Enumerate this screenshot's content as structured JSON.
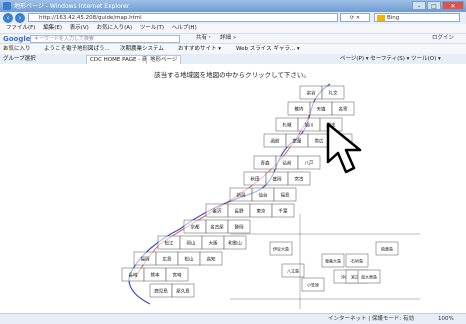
{
  "window": {
    "title": "地形ページ - Windows Internet Explorer",
    "buttons": [
      "–",
      "□",
      "✕"
    ]
  },
  "address_bar": {
    "url": "http://163.42.45.208/guide/map.html",
    "search_value": "Bing"
  },
  "menu": [
    "ファイル(F)",
    "編集(E)",
    "表示(V)",
    "お気に入り(A)",
    "ツール(T)",
    "ヘルプ(H)"
  ],
  "google_toolbar": {
    "logo": "Google",
    "search_placeholder": "キーワードを入力して検索",
    "share_label": "共有・",
    "more_label": "詳細 »",
    "login_label": "ログイン"
  },
  "favorites_bar": {
    "label": "お気に入り",
    "items": [
      "ようこそ電子地形図ぱう...",
      "次期農業システム",
      "おすすめサイト ▾",
      "Web スライス ギャラ... ▾"
    ]
  },
  "tab_bar": {
    "group_label": "グループ選択",
    "tabs": [
      "CDC HOME PAGE - 商品...",
      "地形ページ"
    ],
    "tools_label": "ページ(P) ▾  セーフティ(S) ▾  ツール(O) ▾"
  },
  "content": {
    "instruction": "該当する地域図を地図の中からクリックして下さい。",
    "rows": [
      {
        "cells": [
          {
            "label": "宗谷",
            "interactable": true
          },
          {
            "label": "礼文",
            "interactable": true
          }
        ]
      },
      {
        "cells": [
          {
            "label": "稚内",
            "interactable": true
          },
          {
            "label": "天塩",
            "interactable": true
          },
          {
            "label": "名寄",
            "interactable": true
          }
        ]
      },
      {
        "cells": [
          {
            "label": "札幌",
            "interactable": true
          },
          {
            "label": "旭川",
            "interactable": true
          },
          {
            "label": "網走",
            "interactable": true
          }
        ]
      },
      {
        "cells": [
          {
            "label": "函館",
            "interactable": true
          },
          {
            "label": "室蘭",
            "interactable": true
          },
          {
            "label": "帯広",
            "interactable": true
          },
          {
            "label": "釧路",
            "interactable": true
          }
        ]
      },
      {
        "cells": [
          {
            "label": "青森",
            "interactable": true
          },
          {
            "label": "弘前",
            "interactable": true
          },
          {
            "label": "八戸",
            "interactable": true
          }
        ]
      },
      {
        "cells": [
          {
            "label": "秋田",
            "interactable": true
          },
          {
            "label": "盛岡",
            "interactable": true
          },
          {
            "label": "宮古",
            "interactable": true
          }
        ]
      },
      {
        "cells": [
          {
            "label": "新潟",
            "interactable": true
          },
          {
            "label": "仙台",
            "interactable": true
          },
          {
            "label": "福島",
            "interactable": true
          }
        ]
      },
      {
        "cells": [
          {
            "label": "金沢",
            "interactable": true
          },
          {
            "label": "長野",
            "interactable": true
          },
          {
            "label": "東京",
            "interactable": true
          },
          {
            "label": "千葉",
            "interactable": true
          }
        ]
      },
      {
        "cells": [
          {
            "label": "京都",
            "interactable": true
          },
          {
            "label": "名古屋",
            "interactable": true
          },
          {
            "label": "静岡",
            "interactable": true
          }
        ]
      },
      {
        "cells": [
          {
            "label": "松江",
            "interactable": true
          },
          {
            "label": "岡山",
            "interactable": true
          },
          {
            "label": "大阪",
            "interactable": true
          },
          {
            "label": "和歌山",
            "interactable": true
          }
        ]
      },
      {
        "cells": [
          {
            "label": "福岡",
            "interactable": true
          },
          {
            "label": "広島",
            "interactable": true
          },
          {
            "label": "松山",
            "interactable": true
          },
          {
            "label": "高知",
            "interactable": true
          }
        ]
      },
      {
        "cells": [
          {
            "label": "長崎",
            "interactable": true
          },
          {
            "label": "熊本",
            "interactable": true
          },
          {
            "label": "宮崎",
            "interactable": true
          }
        ]
      },
      {
        "cells": [
          {
            "label": "鹿児島",
            "interactable": true
          },
          {
            "label": "屋久島",
            "interactable": true
          }
        ]
      }
    ],
    "island_cells": [
      "伊豆大島",
      "八丈島",
      "小笠原",
      "奄美大島",
      "沖縄",
      "石垣島",
      "宮古島",
      "南大東島",
      "硫黄島"
    ]
  },
  "status_bar": {
    "zone": "インターネット | 保護モード: 有効",
    "zoom": "100%"
  },
  "colors": {
    "title_gradient_top": "#9fc0e8",
    "map_blue": "#3a4fc8",
    "map_red": "#d04040",
    "grid": "#555555"
  }
}
